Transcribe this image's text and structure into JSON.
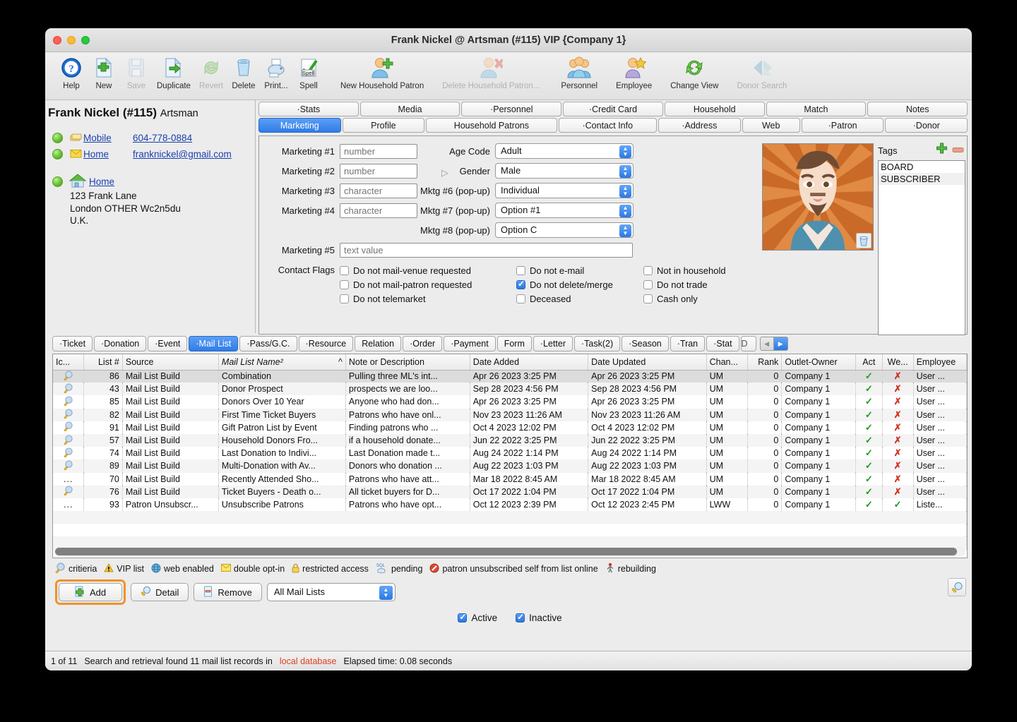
{
  "window": {
    "title": "Frank Nickel @ Artsman (#115) VIP {Company 1}"
  },
  "toolbar": {
    "buttons": [
      {
        "label": "Help",
        "icon": "help-icon",
        "enabled": true
      },
      {
        "label": "New",
        "icon": "new-document-icon",
        "enabled": true
      },
      {
        "label": "Save",
        "icon": "save-floppy-icon",
        "enabled": false
      },
      {
        "label": "Duplicate",
        "icon": "duplicate-icon",
        "enabled": true
      },
      {
        "label": "Revert",
        "icon": "revert-refresh-icon",
        "enabled": false
      },
      {
        "label": "Delete",
        "icon": "trash-icon",
        "enabled": true
      },
      {
        "label": "Print...",
        "icon": "printer-icon",
        "enabled": true
      },
      {
        "label": "Spell",
        "icon": "spell-check-icon",
        "enabled": true
      },
      {
        "label": "New Household Patron",
        "icon": "add-person-icon",
        "enabled": true
      },
      {
        "label": "Delete Household Patron...",
        "icon": "delete-person-icon",
        "enabled": false
      },
      {
        "label": "Personnel",
        "icon": "people-group-icon",
        "enabled": true
      },
      {
        "label": "Employee",
        "icon": "employee-star-icon",
        "enabled": true
      },
      {
        "label": "Change View",
        "icon": "refresh-green-icon",
        "enabled": true
      },
      {
        "label": "Donor Search",
        "icon": "donor-search-icon",
        "enabled": false
      }
    ]
  },
  "patron": {
    "name": "Frank Nickel (#115)",
    "company": "Artsman",
    "contacts": [
      {
        "icon": "phone-card-icon",
        "label": "Mobile",
        "value": "604-778-0884"
      },
      {
        "icon": "envelope-icon",
        "label": "Home",
        "value": "franknickel@gmail.com"
      }
    ],
    "address": {
      "icon": "house-icon",
      "label": "Home",
      "lines": [
        "123 Frank Lane",
        "London OTHER  Wc2n5du",
        "U.K."
      ]
    }
  },
  "top_tabs_row1": [
    {
      "label": "·Stats",
      "selected": false
    },
    {
      "label": "Media",
      "selected": false
    },
    {
      "label": "·Personnel",
      "selected": false
    },
    {
      "label": "·Credit Card",
      "selected": false
    },
    {
      "label": "Household",
      "selected": false
    },
    {
      "label": "Match",
      "selected": false
    },
    {
      "label": "Notes",
      "selected": false
    }
  ],
  "top_tabs_row2": [
    {
      "label": "Marketing",
      "selected": true
    },
    {
      "label": "Profile",
      "selected": false
    },
    {
      "label": "Household Patrons",
      "selected": false
    },
    {
      "label": "·Contact Info",
      "selected": false
    },
    {
      "label": "·Address",
      "selected": false
    },
    {
      "label": "Web",
      "selected": false
    },
    {
      "label": "·Patron",
      "selected": false
    },
    {
      "label": "·Donor",
      "selected": false
    }
  ],
  "marketing": {
    "fields_left": [
      {
        "label": "Marketing #1",
        "placeholder": "number",
        "value": ""
      },
      {
        "label": "Marketing #2",
        "placeholder": "number",
        "value": ""
      },
      {
        "label": "Marketing #3",
        "placeholder": "character",
        "value": ""
      },
      {
        "label": "Marketing #4",
        "placeholder": "character",
        "value": ""
      }
    ],
    "fields_right": [
      {
        "label": "Age Code",
        "value": "Adult"
      },
      {
        "label": "Gender",
        "value": "Male",
        "has_pointer_icon": true
      },
      {
        "label": "Mktg #6 (pop-up)",
        "value": "Individual"
      },
      {
        "label": "Mktg #7 (pop-up)",
        "value": "Option #1"
      },
      {
        "label": "Mktg #8 (pop-up)",
        "value": "Option C"
      }
    ],
    "marketing5": {
      "label": "Marketing #5",
      "placeholder": "text value",
      "value": ""
    },
    "contact_flags_label": "Contact Flags",
    "flags_col1": [
      {
        "label": "Do not mail-venue requested",
        "checked": false
      },
      {
        "label": "Do not mail-patron requested",
        "checked": false
      },
      {
        "label": "Do not telemarket",
        "checked": false
      }
    ],
    "flags_col2": [
      {
        "label": "Do not e-mail",
        "checked": false
      },
      {
        "label": "Do not delete/merge",
        "checked": true
      },
      {
        "label": "Deceased",
        "checked": false
      }
    ],
    "flags_col3": [
      {
        "label": "Not in household",
        "checked": false
      },
      {
        "label": "Do not trade",
        "checked": false
      },
      {
        "label": "Cash only",
        "checked": false
      }
    ]
  },
  "tags": {
    "title": "Tags",
    "add_icon": "plus-icon",
    "remove_icon": "minus-icon",
    "items": [
      "BOARD",
      "SUBSCRIBER"
    ]
  },
  "bottom_tabs": [
    {
      "label": "·Ticket",
      "selected": false
    },
    {
      "label": "·Donation",
      "selected": false
    },
    {
      "label": "·Event",
      "selected": false
    },
    {
      "label": "·Mail List",
      "selected": true
    },
    {
      "label": "·Pass/G.C.",
      "selected": false
    },
    {
      "label": "·Resource",
      "selected": false
    },
    {
      "label": "Relation",
      "selected": false
    },
    {
      "label": "·Order",
      "selected": false
    },
    {
      "label": "·Payment",
      "selected": false
    },
    {
      "label": "Form",
      "selected": false
    },
    {
      "label": "·Letter",
      "selected": false
    },
    {
      "label": "·Task(2)",
      "selected": false
    },
    {
      "label": "·Season",
      "selected": false
    },
    {
      "label": "·Tran",
      "selected": false
    },
    {
      "label": "·Stat",
      "selected": false
    },
    {
      "label": "D",
      "selected": false
    }
  ],
  "table": {
    "columns": [
      "Ic...",
      "List #",
      "Source",
      "Mail List Name²",
      "Note or Description",
      "Date Added",
      "Date Updated",
      "Chan...",
      "Rank",
      "Outlet-Owner",
      "Act",
      "We...",
      "Employee"
    ],
    "sort_column": "Mail List Name²",
    "sort_indicator": "^",
    "rows": [
      {
        "icon": "criteria-icon",
        "list_num": "86",
        "source": "Mail List Build",
        "name": "Combination",
        "note": "Pulling three ML's int...",
        "added": "Apr 26 2023 3:25 PM",
        "updated": "Apr 26 2023 3:25 PM",
        "chan": "UM",
        "rank": "0",
        "owner": "Company 1",
        "act": "check",
        "web": "cross",
        "employee": "User ..."
      },
      {
        "icon": "criteria-icon",
        "list_num": "43",
        "source": "Mail List Build",
        "name": "Donor Prospect",
        "note": "prospects we are loo...",
        "added": "Sep 28 2023 4:56 PM",
        "updated": "Sep 28 2023 4:56 PM",
        "chan": "UM",
        "rank": "0",
        "owner": "Company 1",
        "act": "check",
        "web": "cross",
        "employee": "User ..."
      },
      {
        "icon": "criteria-icon",
        "list_num": "85",
        "source": "Mail List Build",
        "name": "Donors Over 10 Year",
        "note": "Anyone who had don...",
        "added": "Apr 26 2023 3:25 PM",
        "updated": "Apr 26 2023 3:25 PM",
        "chan": "UM",
        "rank": "0",
        "owner": "Company 1",
        "act": "check",
        "web": "cross",
        "employee": "User ..."
      },
      {
        "icon": "criteria-icon",
        "list_num": "82",
        "source": "Mail List Build",
        "name": "First Time Ticket Buyers",
        "note": "Patrons who have onl...",
        "added": "Nov 23 2023 11:26 AM",
        "updated": "Nov 23 2023 11:26 AM",
        "chan": "UM",
        "rank": "0",
        "owner": "Company 1",
        "act": "check",
        "web": "cross",
        "employee": "User ..."
      },
      {
        "icon": "criteria-icon",
        "list_num": "91",
        "source": "Mail List Build",
        "name": "Gift Patron List by Event",
        "note": "Finding patrons who ...",
        "added": "Oct 4 2023 12:02 PM",
        "updated": "Oct 4 2023 12:02 PM",
        "chan": "UM",
        "rank": "0",
        "owner": "Company 1",
        "act": "check",
        "web": "cross",
        "employee": "User ..."
      },
      {
        "icon": "criteria-icon",
        "list_num": "57",
        "source": "Mail List Build",
        "name": "Household Donors Fro...",
        "note": "if a household donate...",
        "added": "Jun 22 2022 3:25 PM",
        "updated": "Jun 22 2022 3:25 PM",
        "chan": "UM",
        "rank": "0",
        "owner": "Company 1",
        "act": "check",
        "web": "cross",
        "employee": "User ..."
      },
      {
        "icon": "criteria-icon",
        "list_num": "74",
        "source": "Mail List Build",
        "name": "Last Donation to Indivi...",
        "note": "Last Donation made t...",
        "added": "Aug 24 2022 1:14 PM",
        "updated": "Aug 24 2022 1:14 PM",
        "chan": "UM",
        "rank": "0",
        "owner": "Company 1",
        "act": "check",
        "web": "cross",
        "employee": "User ..."
      },
      {
        "icon": "criteria-icon",
        "list_num": "89",
        "source": "Mail List Build",
        "name": "Multi-Donation with Av...",
        "note": "Donors who donation ...",
        "added": "Aug 22 2023 1:03 PM",
        "updated": "Aug 22 2023 1:03 PM",
        "chan": "UM",
        "rank": "0",
        "owner": "Company 1",
        "act": "check",
        "web": "cross",
        "employee": "User ..."
      },
      {
        "icon": "ellipsis",
        "list_num": "70",
        "source": "Mail List Build",
        "name": "Recently Attended Sho...",
        "note": "Patrons who have att...",
        "added": "Mar 18 2022 8:45 AM",
        "updated": "Mar 18 2022 8:45 AM",
        "chan": "UM",
        "rank": "0",
        "owner": "Company 1",
        "act": "check",
        "web": "cross",
        "employee": "User ..."
      },
      {
        "icon": "criteria-icon",
        "list_num": "76",
        "source": "Mail List Build",
        "name": "Ticket Buyers - Death o...",
        "note": "All ticket buyers for D...",
        "added": "Oct 17 2022 1:04 PM",
        "updated": "Oct 17 2022 1:04 PM",
        "chan": "UM",
        "rank": "0",
        "owner": "Company 1",
        "act": "check",
        "web": "cross",
        "employee": "User ..."
      },
      {
        "icon": "ellipsis",
        "list_num": "93",
        "source": "Patron Unsubscr...",
        "name": "Unsubscribe Patrons",
        "note": "Patrons who have opt...",
        "added": "Oct 12 2023 2:39 PM",
        "updated": "Oct 12 2023 2:45 PM",
        "chan": "LWW",
        "rank": "0",
        "owner": "Company 1",
        "act": "check",
        "web": "check",
        "employee": "Liste..."
      }
    ]
  },
  "legend": [
    {
      "icon": "criteria-icon",
      "label": "critieria"
    },
    {
      "icon": "warning-icon",
      "label": "VIP list"
    },
    {
      "icon": "globe-icon",
      "label": "web enabled"
    },
    {
      "icon": "envelope-icon",
      "label": "double opt-in"
    },
    {
      "icon": "lock-icon",
      "label": "restricted access"
    },
    {
      "icon": "sql-icon",
      "label": "pending"
    },
    {
      "icon": "no-entry-icon",
      "label": "patron unsubscribed self from list online"
    },
    {
      "icon": "rebuilding-icon",
      "label": "rebuilding"
    }
  ],
  "controls": {
    "add_label": "Add",
    "add_icon": "add-plus-icon",
    "detail_label": "Detail",
    "detail_icon": "magnifier-icon",
    "remove_label": "Remove",
    "remove_icon": "remove-page-icon",
    "filter_value": "All Mail Lists",
    "search_icon": "magnifier-icon",
    "highlight_color": "#f0922b"
  },
  "active_filters": [
    {
      "label": "Active",
      "checked": true
    },
    {
      "label": "Inactive",
      "checked": true
    }
  ],
  "status": {
    "counter": "1 of 11",
    "message_pre": "Search and retrieval found 11 mail list records in",
    "source": "local database",
    "elapsed": "Elapsed time: 0.08 seconds"
  }
}
